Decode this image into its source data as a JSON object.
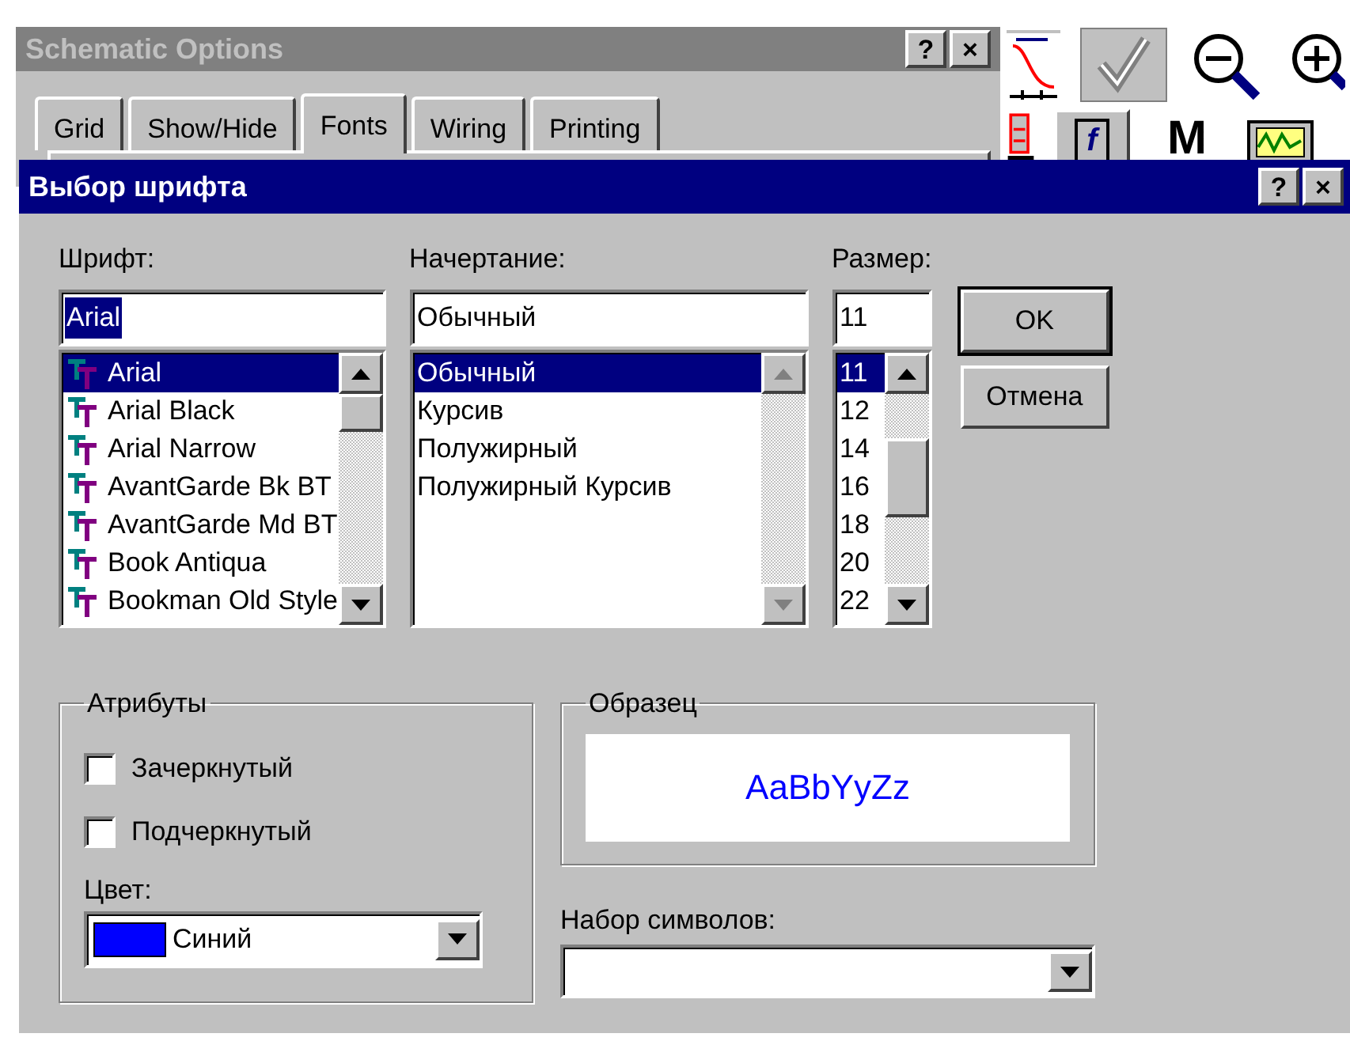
{
  "back_window": {
    "title": "Schematic Options",
    "title_buttons": [
      "?",
      "×"
    ],
    "tabs": [
      {
        "label": "Grid",
        "selected": false
      },
      {
        "label": "Show/Hide",
        "selected": false
      },
      {
        "label": "Fonts",
        "selected": true
      },
      {
        "label": "Wiring",
        "selected": false
      },
      {
        "label": "Printing",
        "selected": false
      }
    ]
  },
  "toolbar": [
    {
      "kind": "waveform"
    },
    {
      "kind": "check"
    },
    {
      "kind": "zoom_out"
    },
    {
      "kind": "zoom_in"
    },
    {
      "kind": "chip"
    },
    {
      "kind": "function",
      "label": "f"
    },
    {
      "kind": "macro",
      "label": "M"
    },
    {
      "kind": "scope"
    }
  ],
  "dialog": {
    "title": "Выбор шрифта",
    "title_buttons": [
      "?",
      "×"
    ],
    "font": {
      "label": "Шрифт:",
      "value": "Arial",
      "value_highlighted": true,
      "scrollbar_disabled": false,
      "items": [
        {
          "label": "Arial",
          "selected": true
        },
        {
          "label": "Arial Black",
          "selected": false
        },
        {
          "label": "Arial Narrow",
          "selected": false
        },
        {
          "label": "AvantGarde Bk BT",
          "selected": false
        },
        {
          "label": "AvantGarde Md BT",
          "selected": false
        },
        {
          "label": "Book Antiqua",
          "selected": false
        },
        {
          "label": "Bookman Old Style",
          "selected": false
        }
      ]
    },
    "style": {
      "label": "Начертание:",
      "value": "Обычный",
      "value_highlighted": false,
      "scrollbar_disabled": true,
      "items": [
        {
          "label": "Обычный",
          "selected": true
        },
        {
          "label": "Курсив",
          "selected": false
        },
        {
          "label": "Полужирный",
          "selected": false
        },
        {
          "label": "Полужирный Курсив",
          "selected": false
        }
      ]
    },
    "size": {
      "label": "Размер:",
      "value": "11",
      "value_highlighted": false,
      "scrollbar_disabled": false,
      "items": [
        {
          "label": "11",
          "selected": true
        },
        {
          "label": "12",
          "selected": false
        },
        {
          "label": "14",
          "selected": false
        },
        {
          "label": "16",
          "selected": false
        },
        {
          "label": "18",
          "selected": false
        },
        {
          "label": "20",
          "selected": false
        },
        {
          "label": "22",
          "selected": false
        }
      ]
    },
    "buttons": [
      {
        "label": "OK",
        "default": true
      },
      {
        "label": "Отмена",
        "default": false
      }
    ],
    "attributes": {
      "title": "Атрибуты",
      "options": [
        {
          "label": "Зачеркнутый",
          "checked": false
        },
        {
          "label": "Подчеркнутый",
          "checked": false
        }
      ],
      "color_label": "Цвет:",
      "color": {
        "label": "Синий",
        "color": "#0000ff"
      }
    },
    "sample": {
      "title": "Образец",
      "text": "AaBbYyZz"
    },
    "charset": {
      "label": "Набор символов:"
    }
  }
}
